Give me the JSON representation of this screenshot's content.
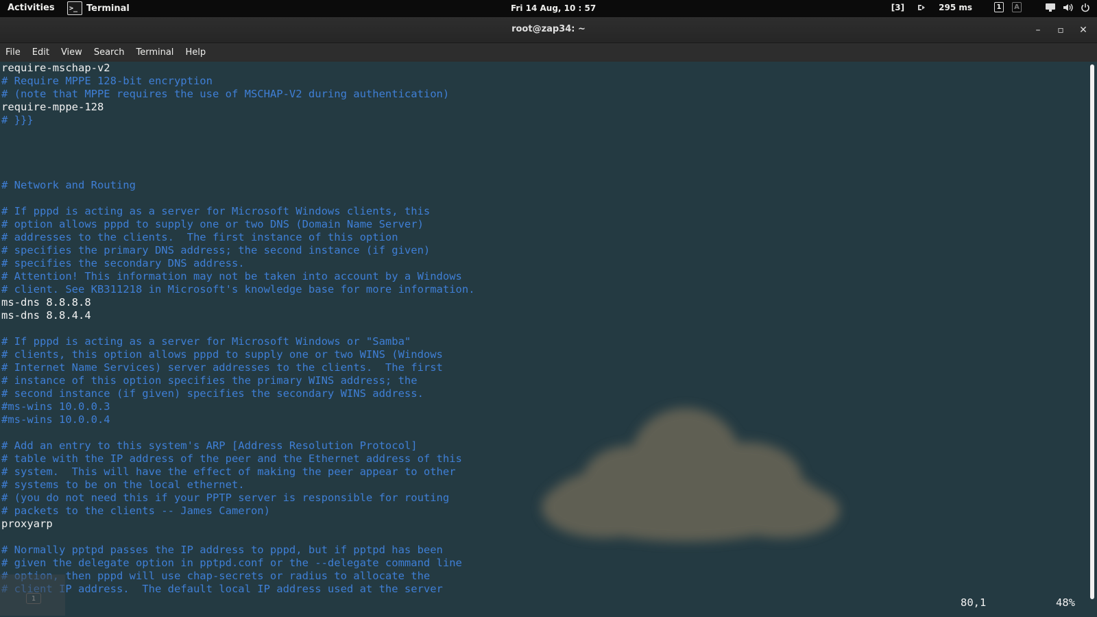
{
  "topbar": {
    "activities": "Activities",
    "app_name": "Terminal",
    "app_icon_glyph": ">_",
    "clock": "Fri 14 Aug, 10 : 57",
    "tray": {
      "workspace": "[3]",
      "ping": "295 ms",
      "kbd_1": "1",
      "kbd_a": "A"
    }
  },
  "window": {
    "title": "root@zap34: ~",
    "minimize": "–",
    "maximize": "▫",
    "close": "✕"
  },
  "menubar": {
    "items": [
      "File",
      "Edit",
      "View",
      "Search",
      "Terminal",
      "Help"
    ]
  },
  "terminal": {
    "lines": [
      {
        "text": "require-mschap-v2",
        "type": "normal"
      },
      {
        "text": "# Require MPPE 128-bit encryption",
        "type": "comment"
      },
      {
        "text": "# (note that MPPE requires the use of MSCHAP-V2 during authentication)",
        "type": "comment"
      },
      {
        "text": "require-mppe-128",
        "type": "normal"
      },
      {
        "text": "# }}}",
        "type": "comment"
      },
      {
        "text": "",
        "type": "normal"
      },
      {
        "text": "",
        "type": "normal"
      },
      {
        "text": "",
        "type": "normal"
      },
      {
        "text": "",
        "type": "normal"
      },
      {
        "text": "# Network and Routing",
        "type": "comment"
      },
      {
        "text": "",
        "type": "normal"
      },
      {
        "text": "# If pppd is acting as a server for Microsoft Windows clients, this",
        "type": "comment"
      },
      {
        "text": "# option allows pppd to supply one or two DNS (Domain Name Server)",
        "type": "comment"
      },
      {
        "text": "# addresses to the clients.  The first instance of this option",
        "type": "comment"
      },
      {
        "text": "# specifies the primary DNS address; the second instance (if given)",
        "type": "comment"
      },
      {
        "text": "# specifies the secondary DNS address.",
        "type": "comment"
      },
      {
        "text": "# Attention! This information may not be taken into account by a Windows",
        "type": "comment"
      },
      {
        "text": "# client. See KB311218 in Microsoft's knowledge base for more information.",
        "type": "comment"
      },
      {
        "text": "ms-dns 8.8.8.8",
        "type": "normal"
      },
      {
        "text": "ms-dns 8.8.4.4",
        "type": "normal"
      },
      {
        "text": "",
        "type": "normal"
      },
      {
        "text": "# If pppd is acting as a server for Microsoft Windows or \"Samba\"",
        "type": "comment"
      },
      {
        "text": "# clients, this option allows pppd to supply one or two WINS (Windows",
        "type": "comment"
      },
      {
        "text": "# Internet Name Services) server addresses to the clients.  The first",
        "type": "comment"
      },
      {
        "text": "# instance of this option specifies the primary WINS address; the",
        "type": "comment"
      },
      {
        "text": "# second instance (if given) specifies the secondary WINS address.",
        "type": "comment"
      },
      {
        "text": "#ms-wins 10.0.0.3",
        "type": "comment"
      },
      {
        "text": "#ms-wins 10.0.0.4",
        "type": "comment"
      },
      {
        "text": "",
        "type": "normal"
      },
      {
        "text": "# Add an entry to this system's ARP [Address Resolution Protocol]",
        "type": "comment"
      },
      {
        "text": "# table with the IP address of the peer and the Ethernet address of this",
        "type": "comment"
      },
      {
        "text": "# system.  This will have the effect of making the peer appear to other",
        "type": "comment"
      },
      {
        "text": "# systems to be on the local ethernet.",
        "type": "comment"
      },
      {
        "text": "# (you do not need this if your PPTP server is responsible for routing",
        "type": "comment"
      },
      {
        "text": "# packets to the clients -- James Cameron)",
        "type": "comment"
      },
      {
        "text": "proxyarp",
        "type": "normal"
      },
      {
        "text": "",
        "type": "normal"
      },
      {
        "text": "# Normally pptpd passes the IP address to pppd, but if pptpd has been",
        "type": "comment"
      },
      {
        "text": "# given the delegate option in pptpd.conf or the --delegate command line",
        "type": "comment"
      },
      {
        "text": "# option, then pppd will use chap-secrets or radius to allocate the",
        "type": "comment"
      },
      {
        "text": "# client IP address.  The default local IP address used at the server",
        "type": "comment"
      }
    ],
    "cursor_position": "80,1",
    "scroll_percent": "48%",
    "cursor_badge": "1"
  },
  "colors": {
    "comment": "#3f7fd6",
    "normal": "#f2f2f2",
    "background": "#243a42"
  }
}
